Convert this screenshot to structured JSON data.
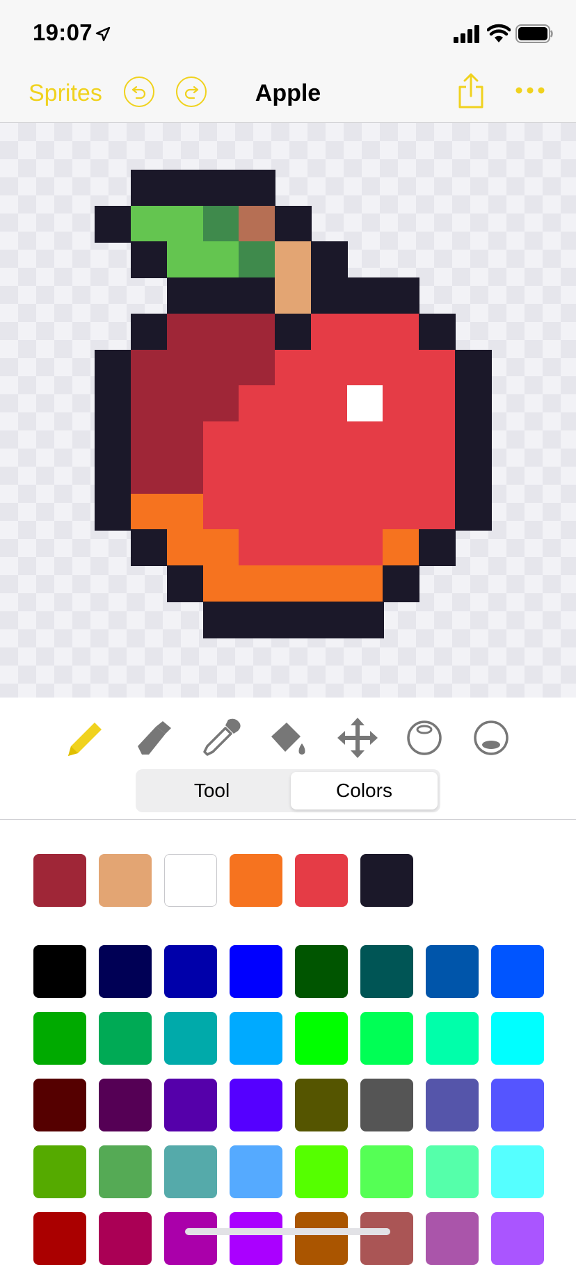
{
  "status_bar": {
    "time": "19:07"
  },
  "nav": {
    "back_label": "Sprites",
    "title": "Apple"
  },
  "tools": [
    {
      "name": "pencil-icon",
      "active": true
    },
    {
      "name": "eraser-icon",
      "active": false
    },
    {
      "name": "eyedropper-icon",
      "active": false
    },
    {
      "name": "paint-bucket-icon",
      "active": false
    },
    {
      "name": "move-icon",
      "active": false
    },
    {
      "name": "circle-outline-icon",
      "active": false
    },
    {
      "name": "circle-fill-icon",
      "active": false
    }
  ],
  "segmented": {
    "tool_label": "Tool",
    "colors_label": "Colors",
    "selected": "Colors"
  },
  "sprite": {
    "palette": {
      ".": null,
      "K": "#1b1829",
      "G": "#64c550",
      "D": "#3f8a4c",
      "B": "#b66f54",
      "T": "#e3a573",
      "R": "#9f2637",
      "E": "#e53c46",
      "O": "#f6731f",
      "W": "#ffffff"
    },
    "rows": [
      "...........",
      "....KKKK...",
      "...KGGDBK..",
      "....KGGDTK.",
      ".....KKKTKKK",
      "....KRRRKEEEK",
      "...KRRRREEEEEK",
      "...KRRREEEWEEK",
      "...KRREEEEEEEK",
      "...KRREEEEEEEK",
      "...KOOEEEEEEEK",
      "....KOOEEEEOK.",
      ".....KOOOOOK..",
      "......KKKKK...",
      "..............",
      ".............."
    ]
  },
  "recent_colors": [
    "#9f2637",
    "#e3a573",
    "#ffffff",
    "#f6731f",
    "#e53c46",
    "#1b1829"
  ],
  "selected_color": "#9f2637",
  "palette_colors": [
    [
      "#000000",
      "#000055",
      "#0000aa",
      "#0000ff",
      "#005500",
      "#005555",
      "#0055aa",
      "#0055ff"
    ],
    [
      "#00aa00",
      "#00aa55",
      "#00aaaa",
      "#00aaff",
      "#00ff00",
      "#00ff55",
      "#00ffaa",
      "#00ffff"
    ],
    [
      "#550000",
      "#550055",
      "#5500aa",
      "#5500ff",
      "#555500",
      "#555555",
      "#5555aa",
      "#5555ff"
    ],
    [
      "#55aa00",
      "#55aa55",
      "#55aaaa",
      "#55aaff",
      "#55ff00",
      "#55ff55",
      "#55ffaa",
      "#55ffff"
    ],
    [
      "#aa0000",
      "#aa0055",
      "#aa00aa",
      "#aa00ff",
      "#aa5500",
      "#aa5555",
      "#aa55aa",
      "#aa55ff"
    ]
  ]
}
